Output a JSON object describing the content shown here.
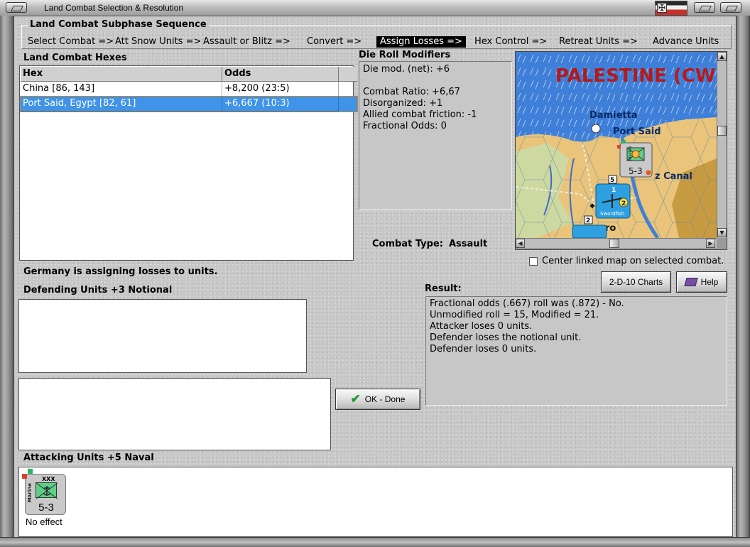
{
  "window": {
    "title": "Land Combat Selection & Resolution"
  },
  "sequence": {
    "title": "Land Combat Subphase Sequence",
    "steps": [
      "Select Combat =>",
      "Att Snow Units =>",
      "Assault or Blitz =>",
      "Convert =>",
      "Assign Losses =>",
      "Hex Control =>",
      "Retreat Units =>",
      "Advance Units"
    ],
    "active_step": "Assign Losses =>"
  },
  "hexes": {
    "title": "Land Combat Hexes",
    "columns": [
      "Hex",
      "Odds"
    ],
    "rows": [
      {
        "hex": "China [86, 143]",
        "odds": "+8,200 (23:5)"
      },
      {
        "hex": "Port Said, Egypt [82, 61]",
        "odds": "+6,667 (10:3)"
      }
    ],
    "selected_row": 1
  },
  "modifiers": {
    "title": "Die Roll Modifiers",
    "lines": [
      "Die mod. (net): +6",
      "",
      "Combat Ratio: +6,67",
      "Disorganized: +1",
      "Allied combat friction: -1",
      "Fractional Odds: 0"
    ]
  },
  "map": {
    "region_label": "PALESTINE (CW",
    "places": [
      "Damietta",
      "Port Said",
      "z Canal",
      "ro"
    ],
    "unit_strength": "5-3",
    "unit_type": "Marine",
    "aircraft_label": "Swordfish",
    "aircraft_values": [
      "1",
      "2"
    ],
    "hex_numbers": [
      "5",
      "2"
    ],
    "colors": {
      "sea": "#3e7fd9",
      "desert": "#e9c47a",
      "farmland": "#cdd9a0",
      "region_label": "#b31b1b",
      "place_label": "#0a2a66"
    }
  },
  "center_linked": {
    "label": "Center linked map on selected combat.",
    "checked": false
  },
  "combat_type": {
    "label": "Combat Type:",
    "value": "Assault"
  },
  "status": {
    "message": "Germany is assigning losses to units."
  },
  "buttons": {
    "charts": "2-D-10 Charts",
    "help": "Help",
    "ok": "OK - Done"
  },
  "defending": {
    "title": "Defending Units +3 Notional"
  },
  "result": {
    "title": "Result:",
    "lines": [
      "Fractional odds (.667) roll was (.872)  - No.",
      "Unmodified roll = 15, Modified = 21.",
      "Attacker loses 0 units.",
      "Defender loses the notional unit.",
      "Defender loses 0 units."
    ]
  },
  "attacking": {
    "title": "Attacking Units +5 Naval",
    "units": [
      {
        "type": "Marine",
        "size": "XXX",
        "strength": "5-3",
        "outcome": "No effect"
      }
    ]
  }
}
